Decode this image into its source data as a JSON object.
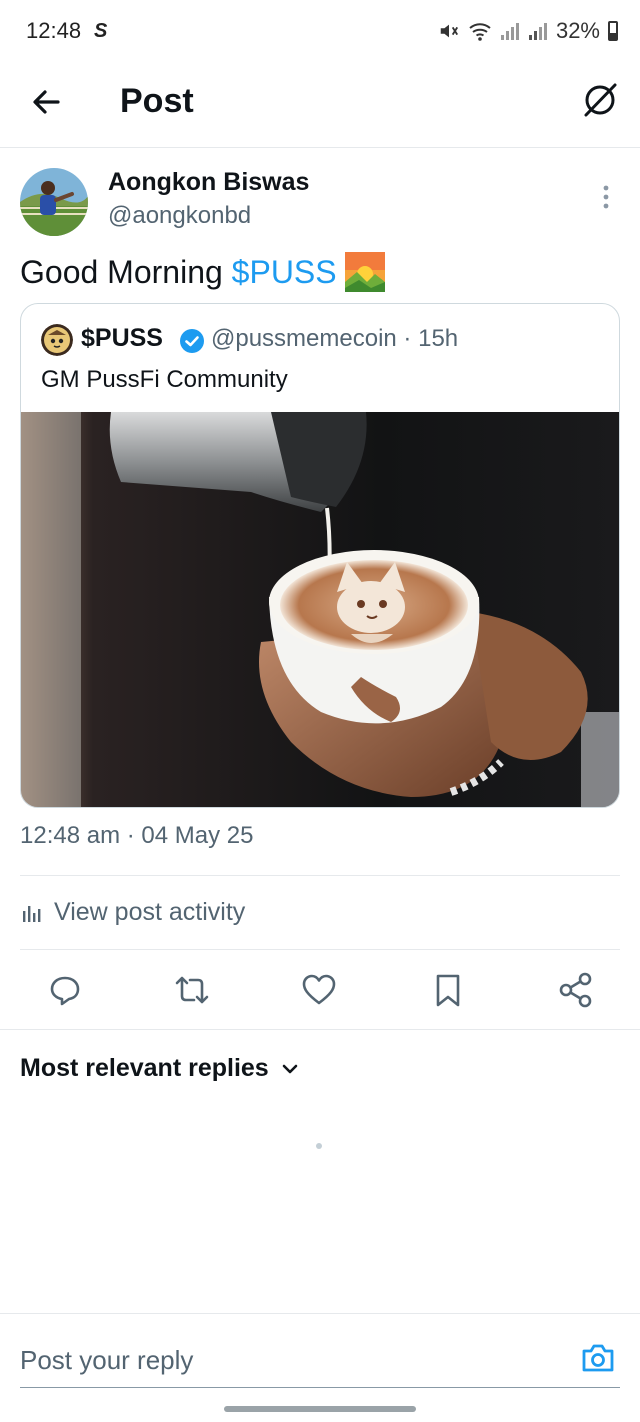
{
  "status_bar": {
    "time": "12:48",
    "carrier_glyph": "S",
    "battery": "32%"
  },
  "header": {
    "title": "Post"
  },
  "post": {
    "author_name": "Aongkon Biswas",
    "author_handle": "@aongkonbd",
    "text_prefix": "Good Morning ",
    "cashtag": "$PUSS",
    "emoji": "sunrise-over-mountains",
    "timestamp": "12:48 am · 04 May 25"
  },
  "quote": {
    "name": "$PUSS",
    "handle_time": "@pussmemecoin · 15h",
    "text": "GM PussFi Community",
    "image_subject": "latte-art-cat-photo"
  },
  "activity": {
    "label": "View post activity"
  },
  "replies": {
    "sort_label": "Most relevant replies"
  },
  "reply_bar": {
    "placeholder": "Post your reply"
  },
  "colors": {
    "accent": "#1d9bf0",
    "text": "#0f1419",
    "muted": "#536471",
    "border": "#cfd9de"
  }
}
